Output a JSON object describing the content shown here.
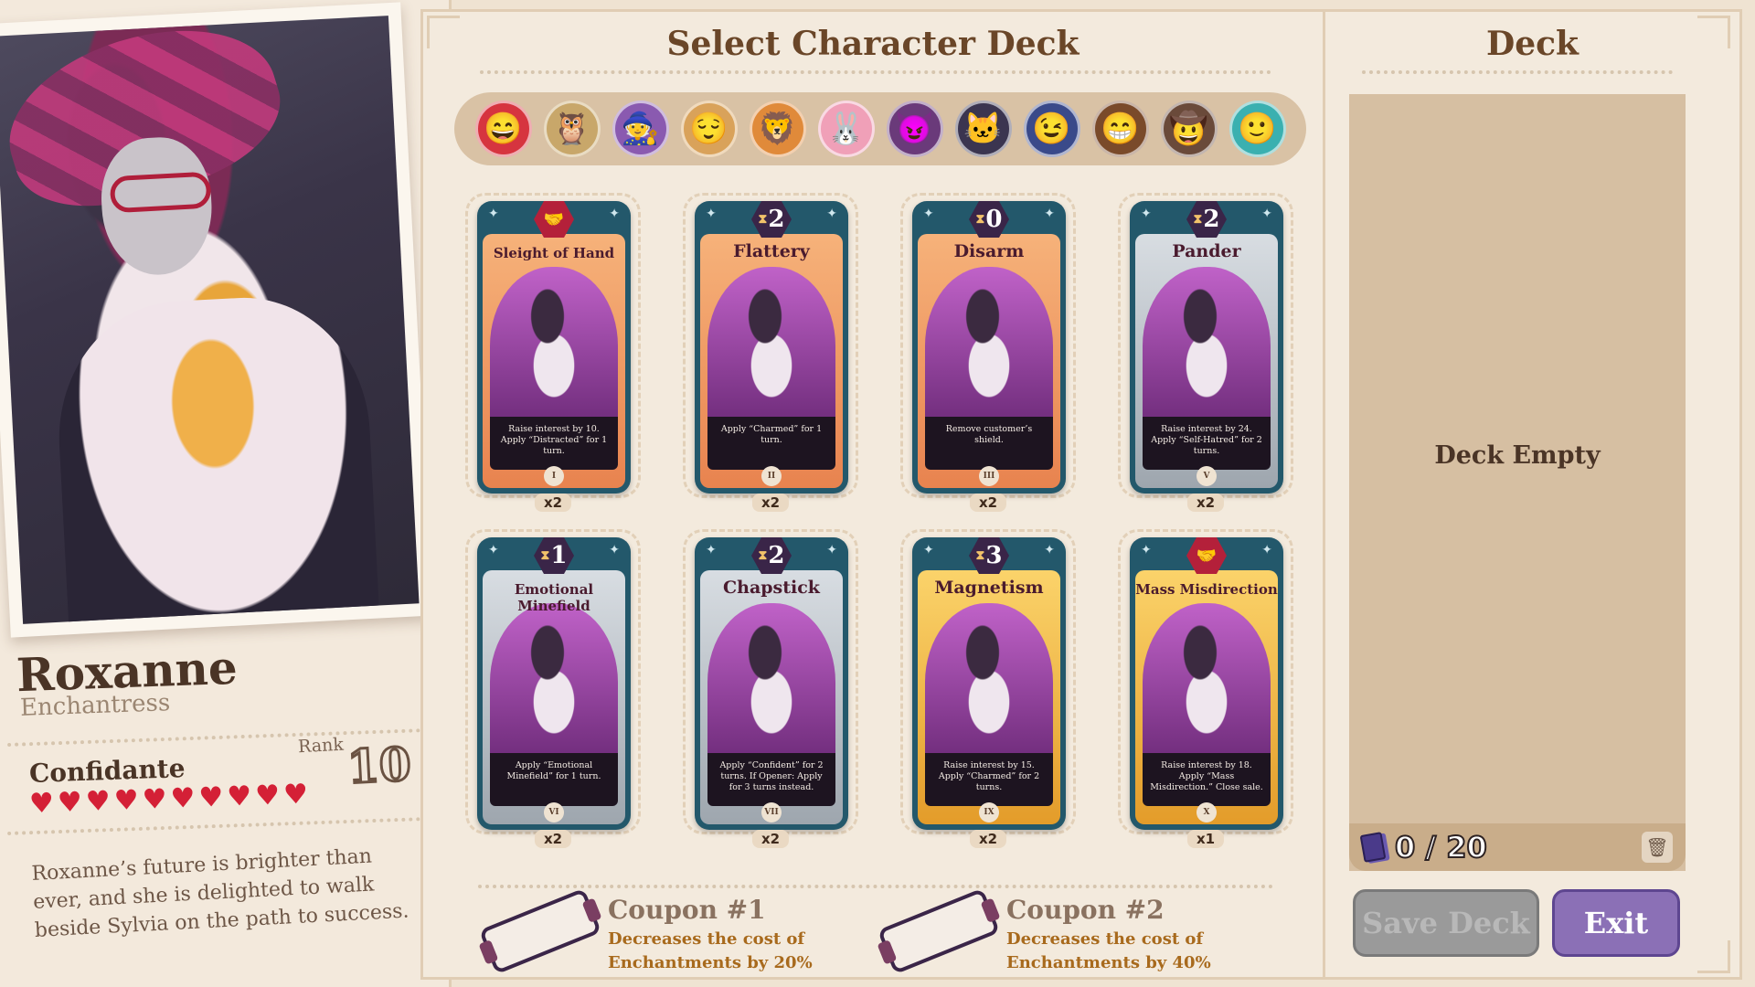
{
  "character": {
    "name": "Roxanne",
    "class": "Enchantress",
    "rank_label": "Rank",
    "rank_value": "10",
    "confidante_label": "Confidante",
    "hearts_filled": 10,
    "bio": "Roxanne’s future is brighter than ever, and she is delighted to walk beside Sylvia on the path to success."
  },
  "main": {
    "title": "Select Character Deck",
    "avatars": [
      {
        "icon": "red-haired-character-icon",
        "glyph": "😄",
        "color": "#d6343f"
      },
      {
        "icon": "owl-character-icon",
        "glyph": "🦉",
        "color": "#c8a76a"
      },
      {
        "icon": "witch-character-icon",
        "glyph": "🧙",
        "color": "#8a5ab0"
      },
      {
        "icon": "bun-character-icon",
        "glyph": "😌",
        "color": "#d9a25a"
      },
      {
        "icon": "lion-character-icon",
        "glyph": "🦁",
        "color": "#e08a3a"
      },
      {
        "icon": "pink-creature-icon",
        "glyph": "🐰",
        "color": "#f0a0b8"
      },
      {
        "icon": "purple-witch-icon",
        "glyph": "😈",
        "color": "#6a3a7a"
      },
      {
        "icon": "cat-duo-icon",
        "glyph": "🐱",
        "color": "#3b3550"
      },
      {
        "icon": "blue-haired-character-icon",
        "glyph": "😉",
        "color": "#3a4a8a"
      },
      {
        "icon": "bearded-character-icon",
        "glyph": "😁",
        "color": "#7a4a2a"
      },
      {
        "icon": "hat-character-icon",
        "glyph": "🤠",
        "color": "#6a4a3a"
      },
      {
        "icon": "teal-haired-character-icon",
        "glyph": "🙂",
        "color": "#3ab0b0"
      }
    ],
    "cards": [
      {
        "title": "Sleight of Hand",
        "cost": "",
        "special": true,
        "numeral": "I",
        "desc": "Raise interest by 10. Apply “Distracted” for 1 turn.",
        "count": "x2",
        "tint": "orange"
      },
      {
        "title": "Flattery",
        "cost": "2",
        "special": false,
        "numeral": "II",
        "desc": "Apply “Charmed” for 1 turn.",
        "count": "x2",
        "tint": "orange"
      },
      {
        "title": "Disarm",
        "cost": "0",
        "special": false,
        "numeral": "III",
        "desc": "Remove customer’s shield.",
        "count": "x2",
        "tint": "orange"
      },
      {
        "title": "Pander",
        "cost": "2",
        "special": false,
        "numeral": "V",
        "desc": "Raise interest by 24. Apply “Self-Hatred” for 2 turns.",
        "count": "x2",
        "tint": "silver"
      },
      {
        "title": "Emotional Minefield",
        "cost": "1",
        "special": false,
        "numeral": "VI",
        "desc": "Apply “Emotional Minefield” for 1 turn.",
        "count": "x2",
        "tint": "silver"
      },
      {
        "title": "Chapstick",
        "cost": "2",
        "special": false,
        "numeral": "VII",
        "desc": "Apply “Confident” for 2 turns. If Opener: Apply for 3 turns instead.",
        "count": "x2",
        "tint": "silver"
      },
      {
        "title": "Magnetism",
        "cost": "3",
        "special": false,
        "numeral": "IX",
        "desc": "Raise interest by 15. Apply “Charmed” for 2 turns.",
        "count": "x2",
        "tint": "gold"
      },
      {
        "title": "Mass Misdirection",
        "cost": "",
        "special": true,
        "numeral": "X",
        "desc": "Raise interest by 18. Apply “Mass Misdirection.” Close sale.",
        "count": "x1",
        "tint": "gold"
      }
    ],
    "coupons": [
      {
        "title": "Coupon #1",
        "desc_line1": "Decreases the cost of",
        "desc_line2": "Enchantments by 20%"
      },
      {
        "title": "Coupon #2",
        "desc_line1": "Decreases the cost of",
        "desc_line2": "Enchantments by 40%"
      }
    ]
  },
  "deck": {
    "title": "Deck",
    "empty_label": "Deck Empty",
    "count": "0 / 20",
    "save_label": "Save Deck",
    "exit_label": "Exit"
  },
  "colors": {
    "heart": "#d42036",
    "accent_button": "#8b70b6",
    "coupon_text": "#a86a1d"
  }
}
